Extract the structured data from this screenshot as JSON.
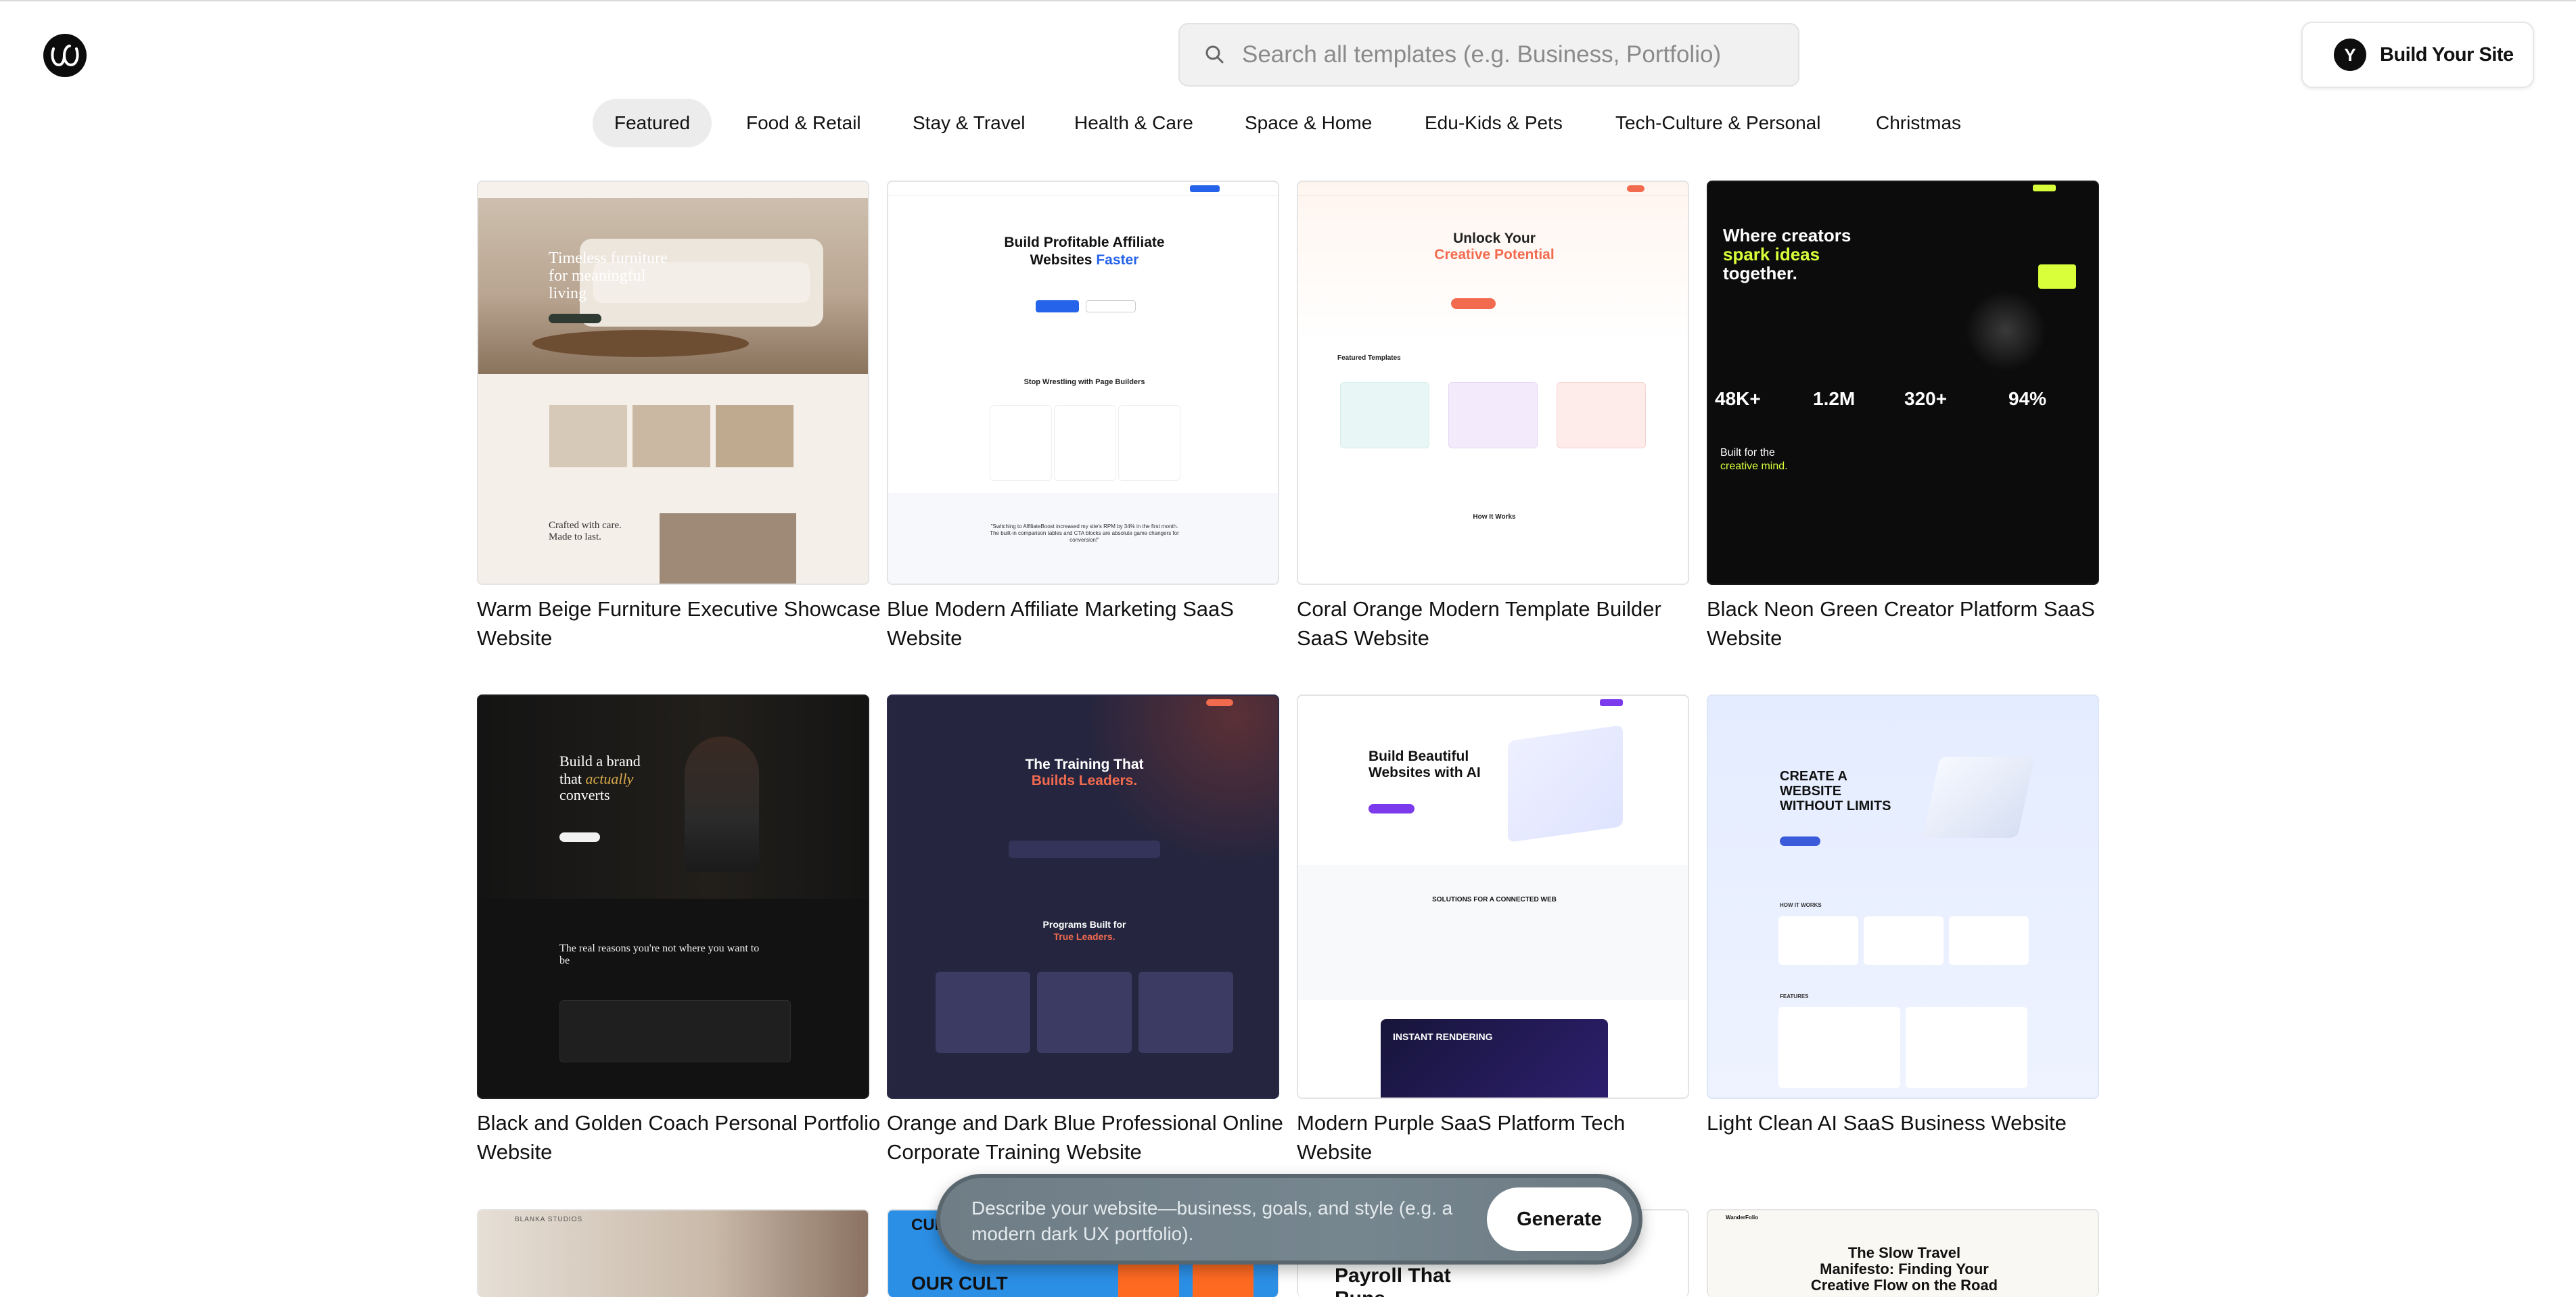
{
  "header": {
    "logo_alt": "logo",
    "search": {
      "placeholder": "Search all templates (e.g. Business, Portfolio)",
      "value": ""
    },
    "build_button": {
      "avatar_letter": "Y",
      "label": "Build Your Site"
    }
  },
  "categories": [
    {
      "label": "Featured",
      "active": true
    },
    {
      "label": "Food & Retail",
      "active": false
    },
    {
      "label": "Stay & Travel",
      "active": false
    },
    {
      "label": "Health & Care",
      "active": false
    },
    {
      "label": "Space & Home",
      "active": false
    },
    {
      "label": "Edu-Kids & Pets",
      "active": false
    },
    {
      "label": "Tech-Culture & Personal",
      "active": false
    },
    {
      "label": "Christmas",
      "active": false
    }
  ],
  "templates": [
    {
      "title": "Warm Beige Furniture Executive Showcase Website"
    },
    {
      "title": "Blue Modern Affiliate Marketing SaaS Website"
    },
    {
      "title": "Coral Orange Modern Template Builder SaaS Website"
    },
    {
      "title": "Black Neon Green Creator Platform SaaS Website"
    },
    {
      "title": "Black and Golden Coach Personal Portfolio Website"
    },
    {
      "title": "Orange and Dark Blue Professional Online Corporate Training Website"
    },
    {
      "title": "Modern Purple SaaS Platform Tech Website"
    },
    {
      "title": "Light Clean AI SaaS Business Website"
    }
  ],
  "thumbs": {
    "t1": {
      "hero": "Timeless furniture for meaningful living",
      "mid": "Crafted with care. Made to last."
    },
    "t2": {
      "h1": "Build Profitable Affiliate",
      "h2": "Websites",
      "h2_accent": "Faster",
      "sub": "Stop Wrestling with Page Builders",
      "quote": "\"Switching to AffiliateBoost increased my site's RPM by 34% in the first month. The built-in comparison tables and CTA blocks are absolute game changers for conversion!\""
    },
    "t3": {
      "h1": "Unlock Your",
      "h2": "Creative Potential",
      "s1": "Featured Templates",
      "s2": "How It Works"
    },
    "t4": {
      "h1": "Where creators",
      "h2": "spark ideas",
      "h3": "together.",
      "stats": [
        "48K+",
        "1.2M",
        "320+",
        "94%"
      ],
      "l1": "Built for the",
      "l2": "creative mind."
    },
    "t5": {
      "h1": "Build a brand",
      "h2": "that",
      "h2_accent": "actually",
      "h3": "converts",
      "s1": "The real reasons you're not where you want to be"
    },
    "t6": {
      "h1": "The Training That",
      "h2": "Builds Leaders.",
      "s1": "Programs Built for",
      "s2": "True Leaders."
    },
    "t7": {
      "h1": "Build Beautiful",
      "h2": "Websites with AI",
      "s1": "SOLUTIONS FOR A CONNECTED WEB",
      "s2": "INSTANT RENDERING"
    },
    "t8": {
      "h1": "CREATE A",
      "h2": "WEBSITE",
      "h3": "WITHOUT LIMITS",
      "s1": "HOW IT WORKS",
      "s2": "FEATURES"
    },
    "t9": {
      "label": "BLANKA STUDIOS"
    },
    "t10": {
      "label": "CUP CL",
      "sub": "OUR CULT"
    },
    "t11": {
      "h1": "Payroll That",
      "h2": "Runs"
    },
    "t12": {
      "brand": "WanderFolio",
      "h1": "The Slow Travel",
      "h2": "Manifesto: Finding Your",
      "h3": "Creative Flow on the Road"
    }
  },
  "generate": {
    "placeholder": "Describe your website—business, goals, and style (e.g. a modern dark UX portfolio).",
    "button": "Generate"
  },
  "colors": {
    "accent_blue": "#2563eb",
    "coral": "#f26b4f",
    "neon_green": "#d8ff3a",
    "purple": "#7c3aed"
  }
}
